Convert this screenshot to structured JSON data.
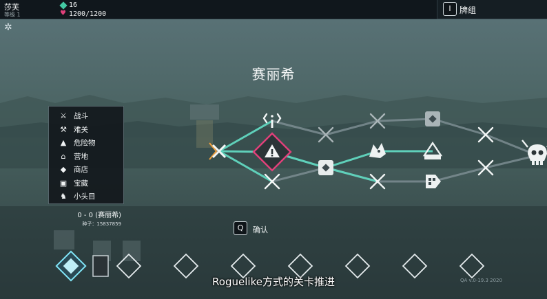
{
  "character": {
    "name": "莎芙",
    "level_label": "等级 1"
  },
  "resources": {
    "gold": "16",
    "hp": "1200/1200"
  },
  "deck": {
    "key": "I",
    "label": "牌组"
  },
  "map": {
    "title": "赛丽希",
    "nodes": [
      {
        "id": "current",
        "type": "battle",
        "state": "current"
      },
      {
        "id": "mystery",
        "type": "mystery"
      },
      {
        "id": "hazard",
        "type": "hazard",
        "state": "selected"
      },
      {
        "id": "battle-a",
        "type": "battle"
      },
      {
        "id": "battle-b",
        "type": "battle"
      },
      {
        "id": "treasure-a",
        "type": "treasure"
      },
      {
        "id": "battle-c",
        "type": "battle"
      },
      {
        "id": "miniboss",
        "type": "miniboss"
      },
      {
        "id": "battle-d",
        "type": "battle"
      },
      {
        "id": "treasure-b",
        "type": "treasure"
      },
      {
        "id": "camp",
        "type": "camp"
      },
      {
        "id": "shop",
        "type": "shop"
      },
      {
        "id": "battle-e",
        "type": "battle"
      },
      {
        "id": "battle-f",
        "type": "battle"
      },
      {
        "id": "boss",
        "type": "boss"
      }
    ]
  },
  "legend": {
    "items": [
      {
        "icon": "crossed-swords-icon",
        "label": "战斗"
      },
      {
        "icon": "pickaxe-icon",
        "label": "难关"
      },
      {
        "icon": "warning-icon",
        "label": "危险物"
      },
      {
        "icon": "camp-icon",
        "label": "营地"
      },
      {
        "icon": "shop-tag-icon",
        "label": "商店"
      },
      {
        "icon": "treasure-icon",
        "label": "宝藏"
      },
      {
        "icon": "miniboss-icon",
        "label": "小头目"
      }
    ]
  },
  "run": {
    "score": "0 - 0 (赛丽希)",
    "seed": "种子：15837859"
  },
  "confirm": {
    "key": "Q",
    "label": "确认"
  },
  "subtitle": "Roguelike方式的关卡推进",
  "version": "QA v.0-19.3 2020",
  "colors": {
    "path": "#5fd0ba",
    "path_dim": "#7c8d92",
    "hazard_border": "#e0407a",
    "gem": "#43c9a3",
    "card_glow": "#7fe3f5"
  }
}
